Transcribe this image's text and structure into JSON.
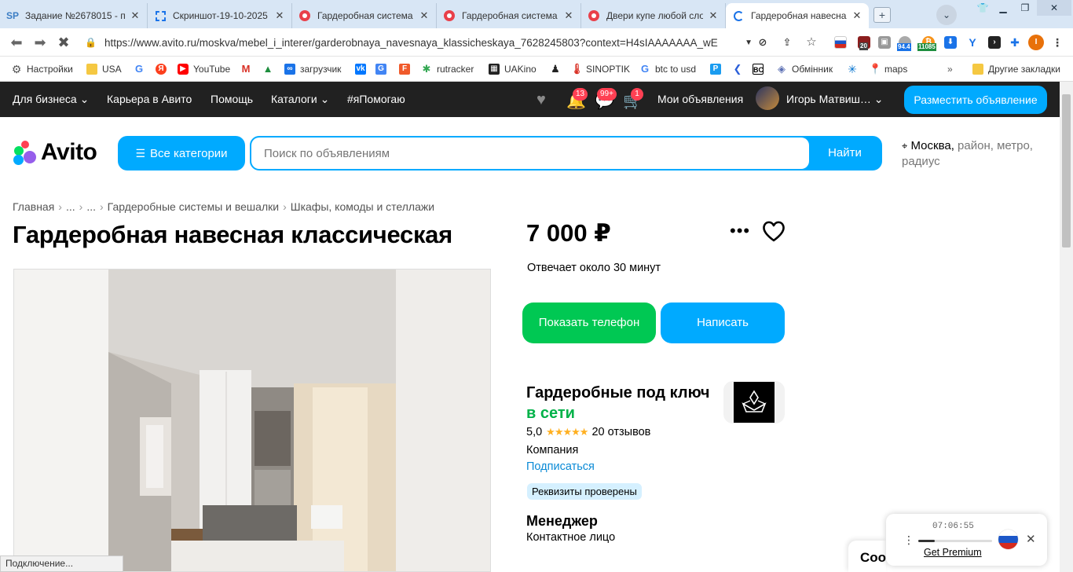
{
  "browser": {
    "tabs": [
      {
        "title": "Задание №2678015 - п"
      },
      {
        "title": "Скриншот-19-10-2025"
      },
      {
        "title": "Гардеробная система"
      },
      {
        "title": "Гардеробная система к"
      },
      {
        "title": "Двери купе любой сло"
      },
      {
        "title": "Гардеробная навесная"
      }
    ],
    "new_tab": "+",
    "url": "https://www.avito.ru/moskva/mebel_i_interer/garderobnaya_navesnaya_klassicheskaya_7628245803?context=H4sIAAAAAAA_wE",
    "ext_badges": {
      "b1": "20",
      "b2": "94.4",
      "b3": "11085"
    },
    "bookmarks": [
      "Настройки",
      "USA",
      "YouTube",
      "загрузчик",
      "rutracker",
      "UAKino",
      "SINOPTIK",
      "btc to usd",
      "Обмінник",
      "maps",
      "Другие закладки"
    ],
    "status_text": "Подключение..."
  },
  "avito_header": {
    "for_business": "Для бизнеса",
    "career": "Карьера в Авито",
    "help": "Помощь",
    "catalogs": "Каталоги",
    "ya_help": "#яПомогаю",
    "badge_notifications": "13",
    "badge_messages": "99+",
    "badge_cart": "1",
    "my_ads": "Мои объявления",
    "user_name": "Игорь Матвиш…",
    "post_ad": "Разместить объявление"
  },
  "search": {
    "logo": "Avito",
    "all_categories": "Все категории",
    "placeholder": "Поиск по объявлениям",
    "find": "Найти",
    "location_city": "Москва,",
    "location_rest": " район, метро, радиус"
  },
  "listing": {
    "breadcrumbs": [
      "Главная",
      "...",
      "...",
      "Гардеробные системы и вешалки",
      "Шкафы, комоды и стеллажи"
    ],
    "title": "Гардеробная навесная классическая",
    "price": "7 000 ₽",
    "more": "•••",
    "reply_time": "Отвечает около 30 минут",
    "show_phone": "Показать телефон",
    "write": "Написать"
  },
  "seller": {
    "name": "Гардеробные под ключ",
    "online": "в сети",
    "rating": "5,0",
    "stars": "★★★★★",
    "reviews": "20 отзывов",
    "type": "Компания",
    "subscribe": "Подписаться",
    "verified": "Реквизиты проверены",
    "manager": "Менеджер",
    "contact": "Контактное лицо"
  },
  "player_widget": {
    "time": "07:06:55",
    "progress": 0.22,
    "premium": "Get Premium"
  },
  "cookie_banner": {
    "text": "Coo"
  },
  "colors": {
    "avito_blue": "#00aaff",
    "avito_green": "#00c853",
    "header_dark": "#212121",
    "badge_red": "#ff4053"
  }
}
